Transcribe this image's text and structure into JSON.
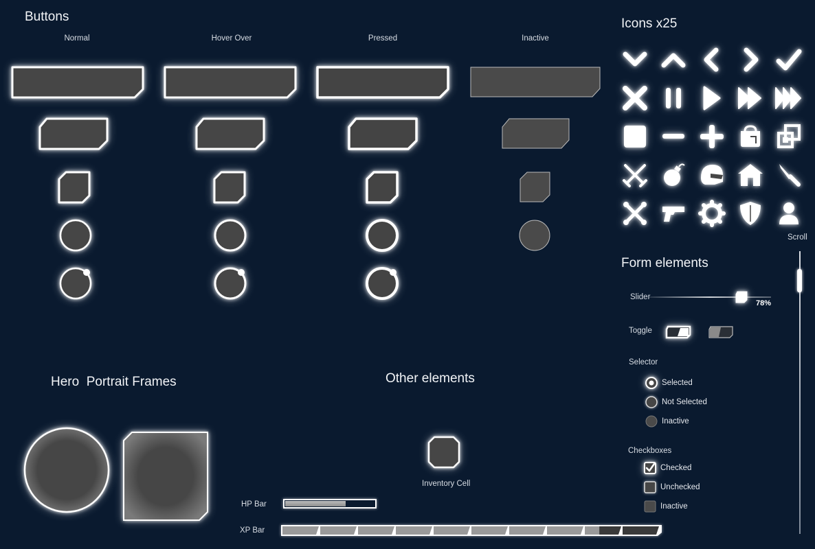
{
  "buttons": {
    "title": "Buttons",
    "states": [
      "Normal",
      "Hover Over",
      "Pressed",
      "Inactive"
    ]
  },
  "icons": {
    "title": "Icons x25",
    "names": [
      "chevron-down-icon",
      "chevron-up-icon",
      "chevron-left-icon",
      "chevron-right-icon",
      "check-icon",
      "close-icon",
      "pause-icon",
      "play-icon",
      "fast-forward-icon",
      "skip-forward-icon",
      "stop-icon",
      "minus-icon",
      "plus-icon",
      "bag-icon",
      "copy-icon",
      "crossed-swords-icon",
      "bomb-icon",
      "helmet-icon",
      "house-icon",
      "knife-icon",
      "crossed-bones-icon",
      "gun-icon",
      "gear-icon",
      "shield-icon",
      "user-icon"
    ]
  },
  "scroll": {
    "label": "Scroll",
    "position": 0.05
  },
  "form": {
    "title": "Form elements",
    "slider": {
      "label": "Slider",
      "value": "78%",
      "fraction": 0.78
    },
    "toggle": {
      "label": "Toggle"
    },
    "selector": {
      "label": "Selector",
      "options": [
        "Selected",
        "Not Selected",
        "Inactive"
      ]
    },
    "checkboxes": {
      "label": "Checkboxes",
      "options": [
        "Checked",
        "Unchecked",
        "Inactive"
      ]
    }
  },
  "hero": {
    "title": "Hero  Portrait Frames"
  },
  "other": {
    "title": "Other elements",
    "inventory_label": "Inventory Cell",
    "hp_label": "HP Bar",
    "hp_fraction": 0.68,
    "xp_label": "XP Bar",
    "xp_segments": 10,
    "xp_filled": 8.4
  },
  "colors": {
    "background": "#0a1a2f",
    "fill": "#464646",
    "stroke": "#ffffff",
    "inactive_stroke": "#9a9a9a"
  }
}
